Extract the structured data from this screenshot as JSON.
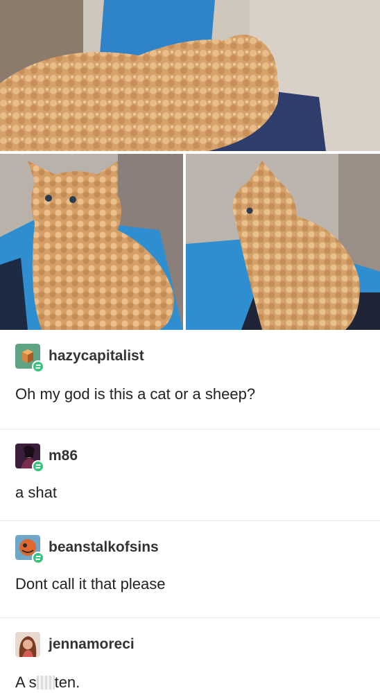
{
  "photos": {
    "top": "cat-photo-top",
    "left": "cat-photo-left",
    "right": "cat-photo-right"
  },
  "replies": [
    {
      "username": "hazycapitalist",
      "text": "Oh my god is this a cat or a sheep?",
      "avatar": "cube-avatar",
      "badge": "reblog-icon"
    },
    {
      "username": "m86",
      "text": "a shat",
      "avatar": "photo-avatar",
      "badge": "reblog-icon"
    },
    {
      "username": "beanstalkofsins",
      "text": "Dont call it that please",
      "avatar": "circle-avatar",
      "badge": "reblog-icon"
    },
    {
      "username": "jennamoreci",
      "text_before": "A s",
      "text_after": "ten.",
      "avatar": "photo-avatar",
      "badge": "none"
    }
  ],
  "colors": {
    "reblog_green": "#3ac37d",
    "divider": "#e6e6e6",
    "fur": "#d8a774"
  }
}
